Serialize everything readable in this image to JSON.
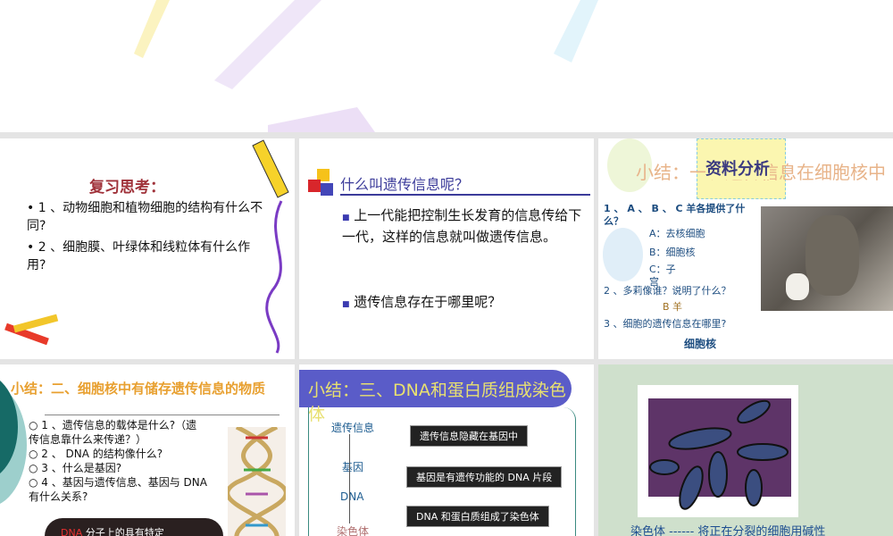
{
  "slide1": {
    "title": "复习思考：",
    "items": [
      "1 、动物细胞和植物细胞的结构有什么不同?",
      "2 、细胞膜、叶绿体和线粒体有什么作用?"
    ]
  },
  "slide2": {
    "title": "什么叫遗传信息呢？",
    "items": [
      "上一代能把控制生长发育的信息传给下一代，这样的信息就叫做遗传信息。",
      "遗传信息存在于哪里呢？"
    ]
  },
  "slide3": {
    "title": "小结：一、遗传信息在细胞核中",
    "banner": "资料分析",
    "q1": "1 、 A 、 B 、 C 羊各提供了什么？",
    "a": "A：去核细胞",
    "b": "B：细胞核",
    "c": "C：子宫",
    "q2": "2 、多莉像谁？说明了什么？",
    "a2": "B 羊",
    "q3": "3 、细胞的遗传信息在哪里?",
    "a3": "细胞核"
  },
  "slide4": {
    "title": "小结：二、细胞核中有储存遗传信息的物质",
    "items": [
      "1 、遗传信息的载体是什么?（遗传信息靠什么来传递？）",
      "2 、 DNA 的结构像什么?",
      "3 、什么是基因?",
      "4 、基因与遗传信息、基因与 DNA 有什么关系?"
    ],
    "cloud_hl": "DNA",
    "cloud": " 分子上的具有特定"
  },
  "slide5": {
    "title": "小结：三、DNA和蛋白质组成染色体",
    "chain": [
      "遗传信息",
      "基因",
      "DNA",
      "染色体"
    ],
    "boxes": [
      "遗传信息隐藏在基因中",
      "基因是有遗传功能的 DNA 片段",
      "DNA 和蛋白质组成了染色体"
    ]
  },
  "slide6": {
    "caption": "染色体 ------ 将正在分裂的细胞用碱性"
  }
}
